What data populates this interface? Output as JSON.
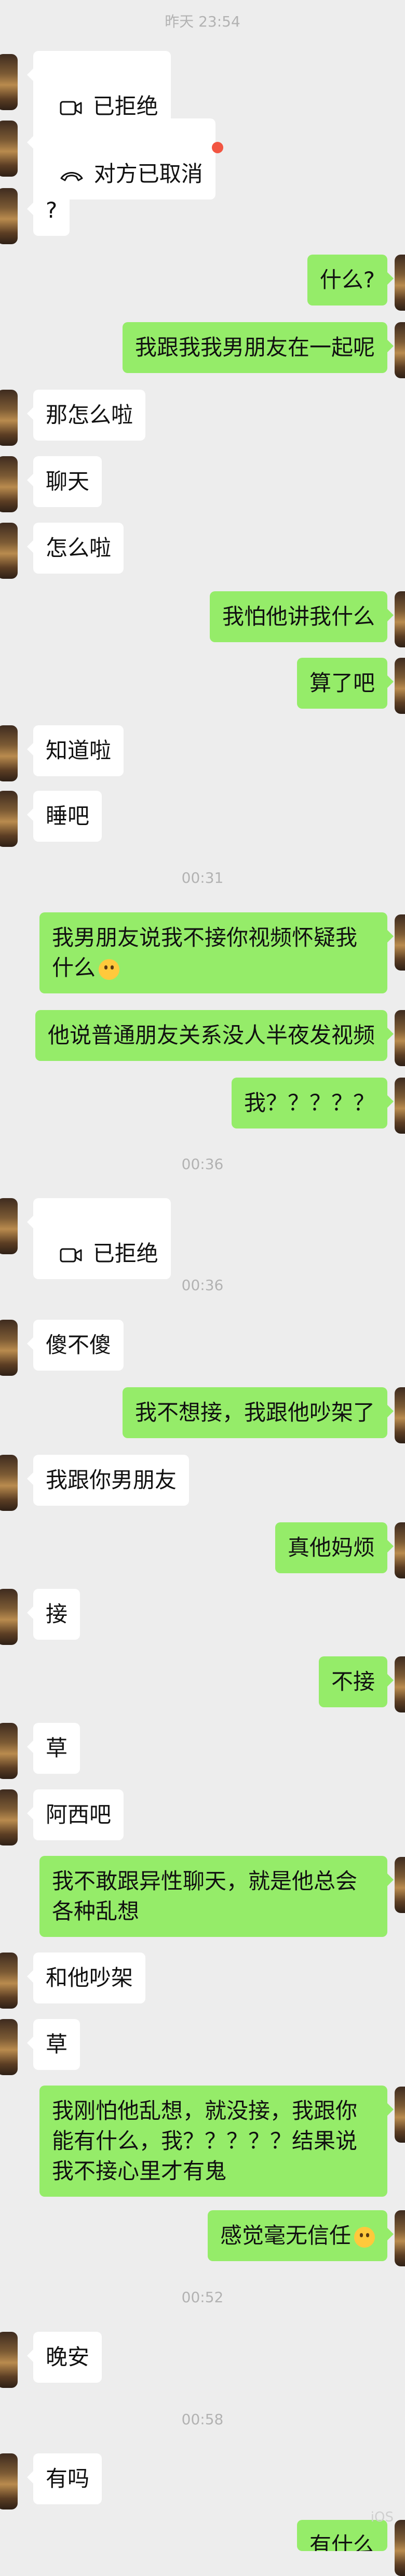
{
  "timestamps": [
    "昨天 23:54",
    "00:31",
    "00:36",
    "00:36",
    "00:52",
    "00:58"
  ],
  "messages": {
    "m1": "已拒绝",
    "m2": "对方已取消",
    "m3": "?",
    "m4": "什么?",
    "m5": "我跟我我男朋友在一起呢",
    "m6": "那怎么啦",
    "m7": "聊天",
    "m8": "怎么啦",
    "m9": "我怕他讲我什么",
    "m10": "算了吧",
    "m11": "知道啦",
    "m12": "睡吧",
    "m13": "我男朋友说我不接你视频怀疑我什么",
    "m14": "他说普通朋友关系没人半夜发视频",
    "m15": "我？？？？？",
    "m16": "已拒绝",
    "m17": "傻不傻",
    "m18": "我不想接，我跟他吵架了",
    "m19": "我跟你男朋友",
    "m20": "真他妈烦",
    "m21": "接",
    "m22": "不接",
    "m23": "草",
    "m24": "阿西吧",
    "m25": "我不敢跟异性聊天，就是他总会各种乱想",
    "m26": "和他吵架",
    "m27": "草",
    "m28": "我刚怕他乱想，就没接，我跟你能有什么，我？？？？？结果说我不接心里才有鬼",
    "m29": "感觉毫无信任",
    "m30": "晚安",
    "m31": "有吗",
    "m32": "有什么"
  },
  "icons": {
    "video_call": "video-camera-icon",
    "voice_call_cancel": "phone-hangup-icon",
    "unread": "red-dot",
    "emoji_smile": "blush-emoji",
    "emoji_think": "thinking-emoji"
  },
  "colors": {
    "background": "#ededed",
    "bubble_self": "#95ec69",
    "bubble_other": "#ffffff",
    "timestamp": "#b2b2b2",
    "unread_dot": "#f25542"
  },
  "watermark": "iOS"
}
